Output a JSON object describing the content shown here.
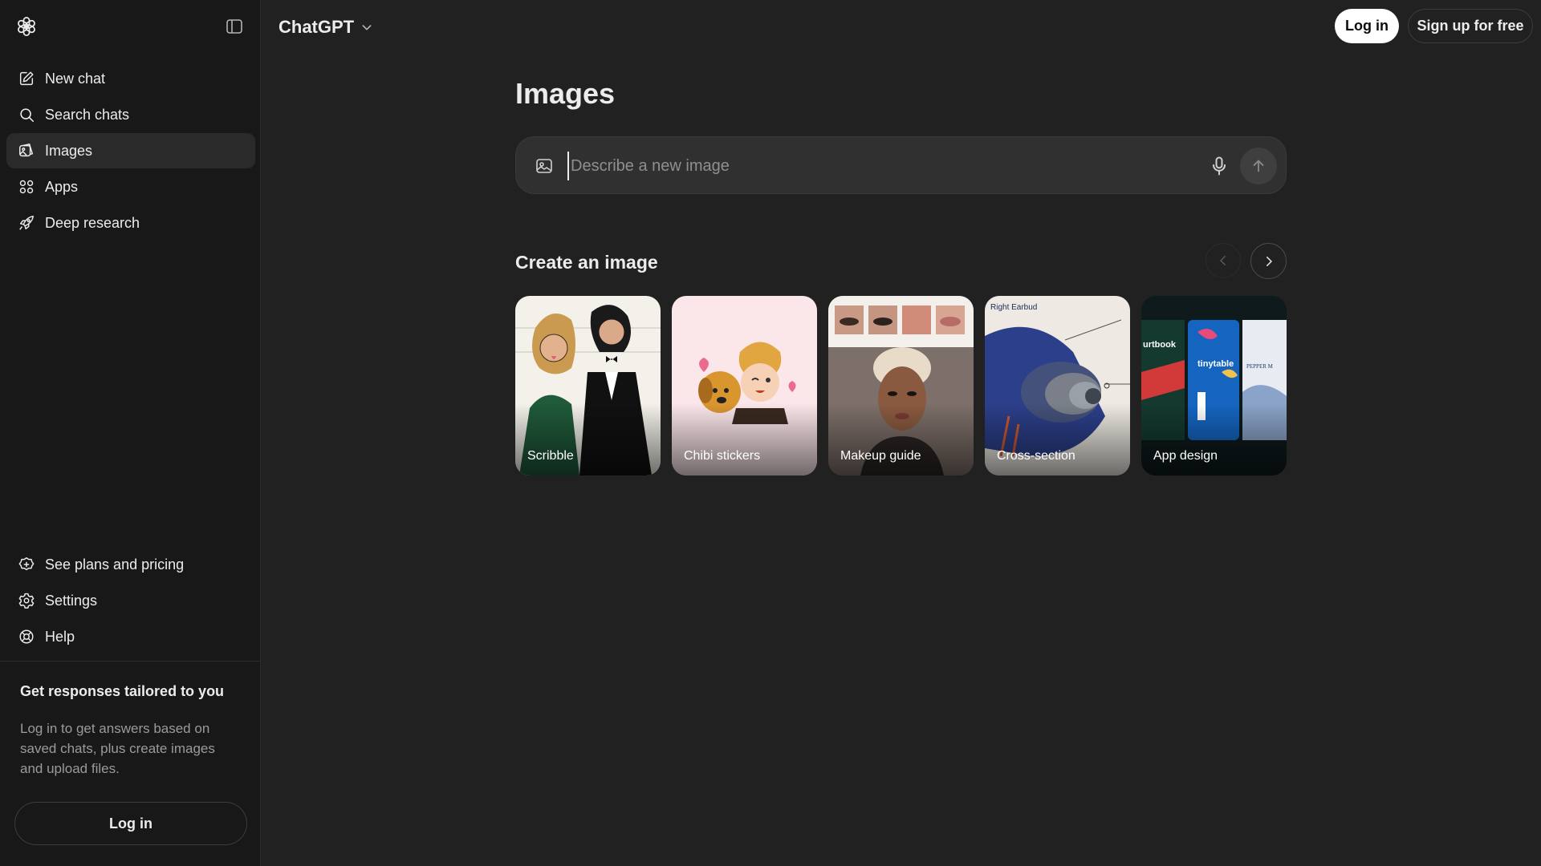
{
  "app": {
    "model_name": "ChatGPT"
  },
  "sidebar": {
    "nav_items": [
      {
        "label": "New chat",
        "icon": "new-chat-icon"
      },
      {
        "label": "Search chats",
        "icon": "search-icon"
      },
      {
        "label": "Images",
        "icon": "images-icon",
        "active": true
      },
      {
        "label": "Apps",
        "icon": "apps-icon"
      },
      {
        "label": "Deep research",
        "icon": "deep-research-icon"
      }
    ],
    "bottom_items": [
      {
        "label": "See plans and pricing",
        "icon": "plans-icon"
      },
      {
        "label": "Settings",
        "icon": "gear-icon"
      },
      {
        "label": "Help",
        "icon": "help-icon"
      }
    ],
    "promo": {
      "title": "Get responses tailored to you",
      "text": "Log in to get answers based on saved chats, plus create images and upload files."
    },
    "login_label": "Log in"
  },
  "header": {
    "login_label": "Log in",
    "signup_label": "Sign up for free"
  },
  "main": {
    "title": "Images",
    "composer": {
      "placeholder": "Describe a new image"
    },
    "section_title": "Create an image",
    "cards": [
      {
        "label": "Scribble"
      },
      {
        "label": "Chibi stickers"
      },
      {
        "label": "Makeup guide"
      },
      {
        "label": "Cross-section",
        "inner_text": "Right Earbud"
      },
      {
        "label": "App design",
        "inner_text": [
          "urtbook",
          "tinytable",
          "PEPPER M"
        ]
      }
    ]
  },
  "colors": {
    "background": "#212121",
    "sidebar": "#181818",
    "active_item": "#2a2a2a",
    "composer": "#303030"
  }
}
